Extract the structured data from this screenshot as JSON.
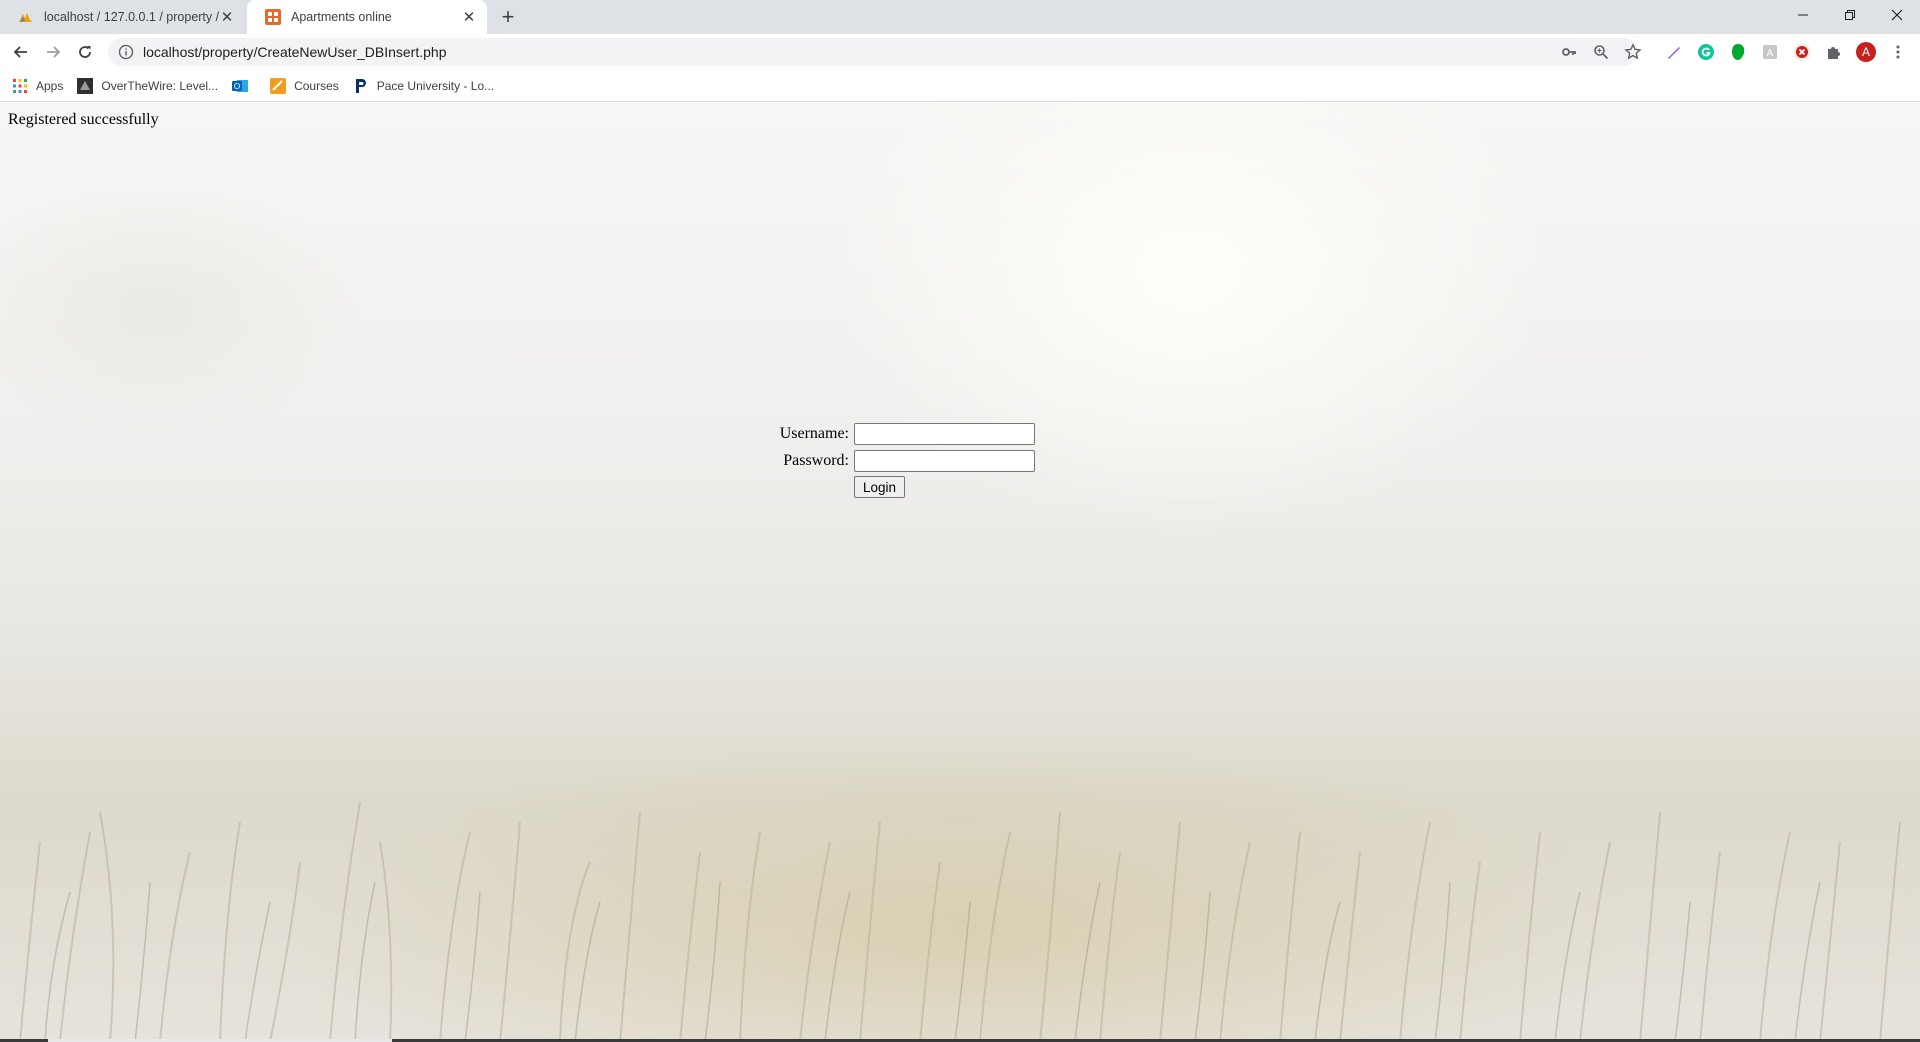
{
  "browser": {
    "tabs": [
      {
        "title": "localhost / 127.0.0.1 / property /",
        "icon": "phpmyadmin-icon",
        "active": false
      },
      {
        "title": "Apartments online",
        "icon": "apartments-favicon",
        "active": true
      }
    ],
    "url": "localhost/property/CreateNewUser_DBInsert.php",
    "profile_initial": "A",
    "bookmarks": [
      {
        "label": "Apps",
        "icon": "apps-grid-icon"
      },
      {
        "label": "OverTheWire: Level...",
        "icon": "overthewire-icon"
      },
      {
        "label": "",
        "icon": "outlook-icon"
      },
      {
        "label": "Courses",
        "icon": "courses-icon"
      },
      {
        "label": "Pace University - Lo...",
        "icon": "pace-icon"
      }
    ],
    "colors": {
      "tabstrip": "#dee1e6",
      "omnibox": "#f1f3f4",
      "profile": "#c5221f"
    }
  },
  "page": {
    "status_message": "Registered successfully",
    "form": {
      "username_label": "Username:",
      "password_label": "Password:",
      "username_value": "",
      "password_value": "",
      "login_label": "Login"
    }
  }
}
